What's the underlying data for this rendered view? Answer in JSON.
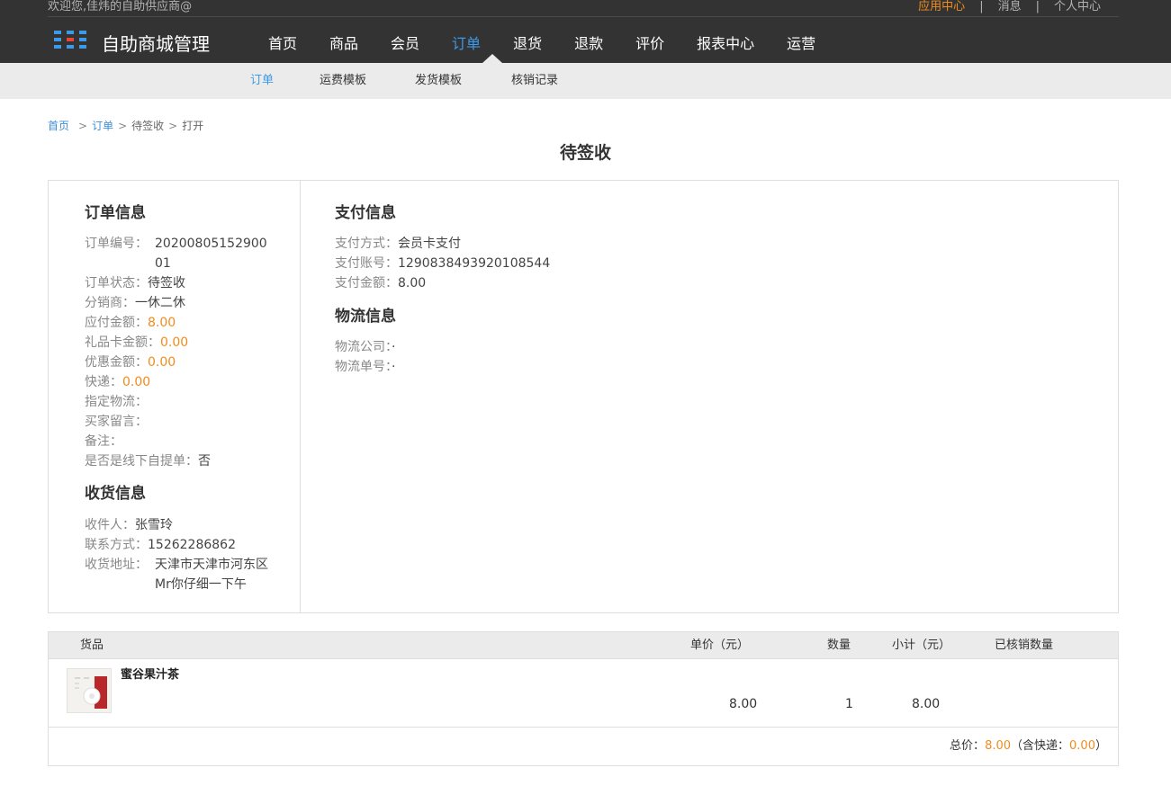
{
  "header": {
    "welcome": "欢迎您,佳炜的自助供应商@",
    "top_links": {
      "app_center": "应用中心",
      "messages": "消息",
      "personal_center": "个人中心",
      "separator": "|"
    },
    "brand": "自助商城管理",
    "nav": [
      {
        "label": "首页"
      },
      {
        "label": "商品"
      },
      {
        "label": "会员"
      },
      {
        "label": "订单"
      },
      {
        "label": "退货"
      },
      {
        "label": "退款"
      },
      {
        "label": "评价"
      },
      {
        "label": "报表中心"
      },
      {
        "label": "运营"
      }
    ],
    "active_nav": "订单",
    "accent_color": "#3d9ae8",
    "highlight_color": "#f08c1d"
  },
  "subnav": [
    {
      "label": "订单"
    },
    {
      "label": "运费模板"
    },
    {
      "label": "发货模板"
    },
    {
      "label": "核销记录"
    }
  ],
  "breadcrumb": {
    "home": "首页",
    "order": "订单",
    "status": "待签收",
    "action": "打开",
    "sep": ">"
  },
  "page_title": "待签收",
  "order_info": {
    "title": "订单信息",
    "order_no_label": "订单编号：",
    "order_no": "2020080515290001",
    "status_label": "订单状态：",
    "status": "待签收",
    "distributor_label": "分销商：",
    "distributor": "一休二休",
    "payable_label": "应付金额：",
    "payable": "8.00",
    "gift_card_label": "礼品卡金额：",
    "gift_card": "0.00",
    "discount_label": "优惠金额：",
    "discount": "0.00",
    "express_label": "快递：",
    "express": "0.00",
    "logistics_label": "指定物流：",
    "buyer_msg_label": "买家留言：",
    "remark_label": "备注：",
    "offline_pickup_label": "是否是线下自提单：",
    "offline_pickup": "否"
  },
  "receiver_info": {
    "title": "收货信息",
    "name_label": "收件人：",
    "name": "张雪玲",
    "phone_label": "联系方式：",
    "phone": "15262286862",
    "address_label": "收货地址：",
    "address": "天津市天津市河东区Mr你仔细一下午"
  },
  "payment_info": {
    "title": "支付信息",
    "method_label": "支付方式：",
    "method": "会员卡支付",
    "account_label": "支付账号：",
    "account": "1290838493920108544",
    "amount_label": "支付金额：",
    "amount": "8.00"
  },
  "logistics_info": {
    "title": "物流信息",
    "company_label": "物流公司：",
    "company": "·",
    "tracking_label": "物流单号：",
    "tracking": "·"
  },
  "goods_table": {
    "columns": [
      "货品",
      "单价（元）",
      "数量",
      "小计（元）",
      "已核销数量"
    ],
    "rows": [
      {
        "name": "蜜谷果汁茶",
        "unit_price": "8.00",
        "qty": "1",
        "subtotal": "8.00",
        "redeemed": ""
      }
    ],
    "footer": {
      "total_label": "总价：",
      "total": "8.00",
      "express_open": "（含快递：",
      "express": "0.00",
      "close": "）"
    }
  }
}
